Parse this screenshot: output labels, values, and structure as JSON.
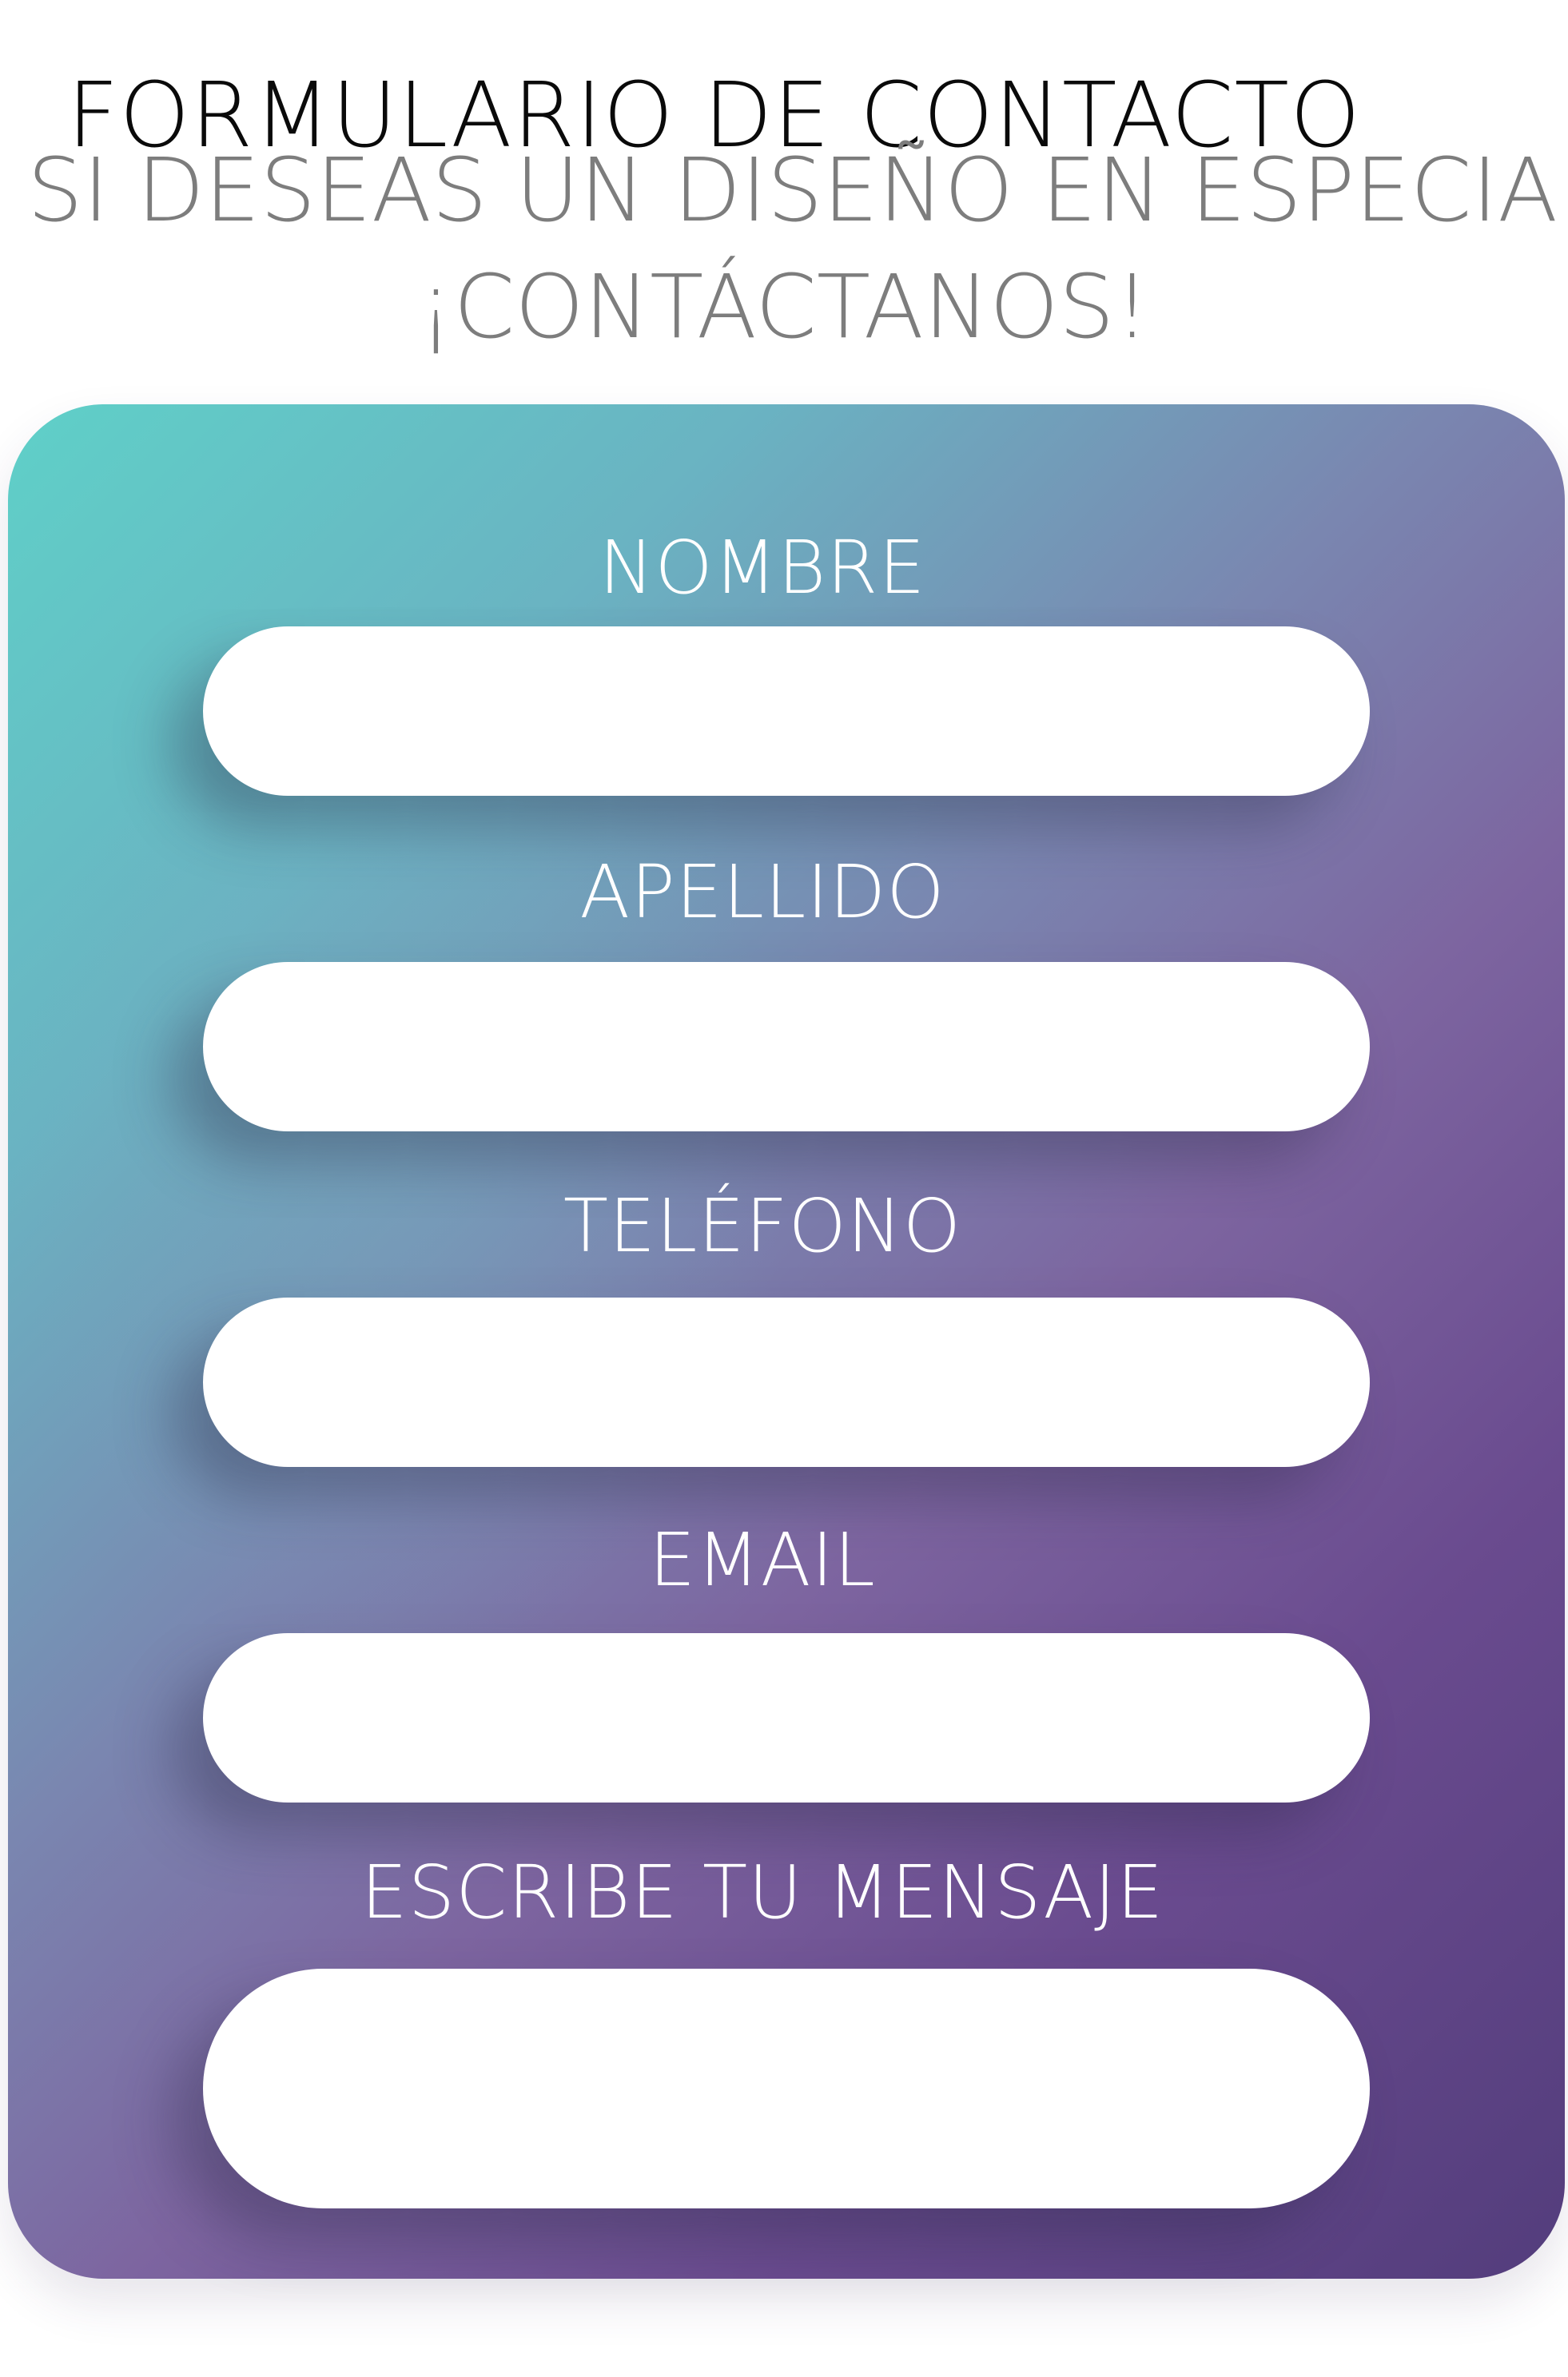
{
  "header": {
    "title": "FORMULARIO DE CONTACTO",
    "subtitle_line1": "SI DESEAS UN DISEÑO EN ESPECIAL",
    "subtitle_line2": "¡CONTÁCTANOS!"
  },
  "form": {
    "fields": [
      {
        "label": "NOMBRE",
        "value": ""
      },
      {
        "label": "APELLIDO",
        "value": ""
      },
      {
        "label": "TELÉFONO",
        "value": ""
      },
      {
        "label": "EMAIL",
        "value": ""
      },
      {
        "label": "ESCRIBE TU MENSAJE",
        "value": ""
      }
    ]
  },
  "colors": {
    "gradient_start": "#5fd0c8",
    "gradient_end": "#533d7c",
    "title": "#0a0a0a",
    "subtitle": "#7d7d7d",
    "label": "#ffffff"
  }
}
